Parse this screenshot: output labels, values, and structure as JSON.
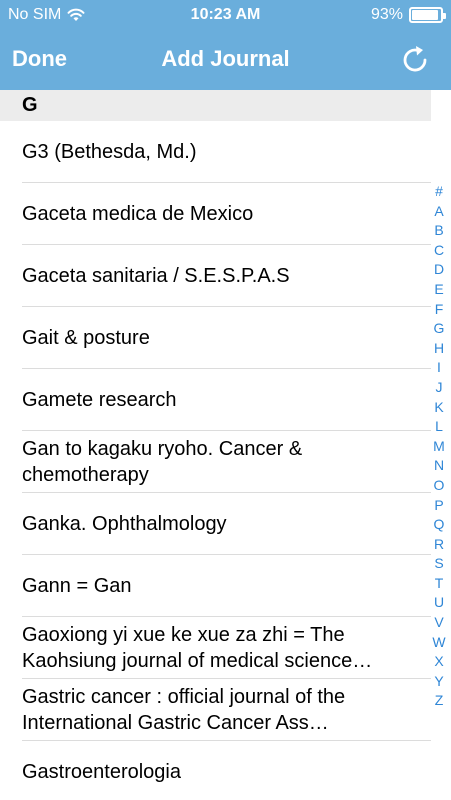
{
  "status": {
    "carrier": "No SIM",
    "time": "10:23 AM",
    "battery": "93%",
    "battery_level": 0.93
  },
  "nav": {
    "done_label": "Done",
    "title": "Add Journal",
    "refresh_icon": "refresh-icon"
  },
  "section": {
    "letter": "G"
  },
  "journals": [
    "G3 (Bethesda, Md.)",
    "Gaceta medica de Mexico",
    "Gaceta sanitaria / S.E.S.P.A.S",
    "Gait & posture",
    "Gamete research",
    "Gan to kagaku ryoho. Cancer & chemotherapy",
    "Ganka. Ophthalmology",
    "Gann = Gan",
    "Gaoxiong yi xue ke xue za zhi = The Kaohsiung journal of medical science…",
    "Gastric cancer  :  official journal of the International Gastric Cancer Ass…",
    "Gastroenterologia"
  ],
  "index": [
    "#",
    "A",
    "B",
    "C",
    "D",
    "E",
    "F",
    "G",
    "H",
    "I",
    "J",
    "K",
    "L",
    "M",
    "N",
    "O",
    "P",
    "Q",
    "R",
    "S",
    "T",
    "U",
    "V",
    "W",
    "X",
    "Y",
    "Z"
  ],
  "colors": {
    "header": "#6aaedc",
    "index": "#2f86d6",
    "section": "#ececec"
  }
}
